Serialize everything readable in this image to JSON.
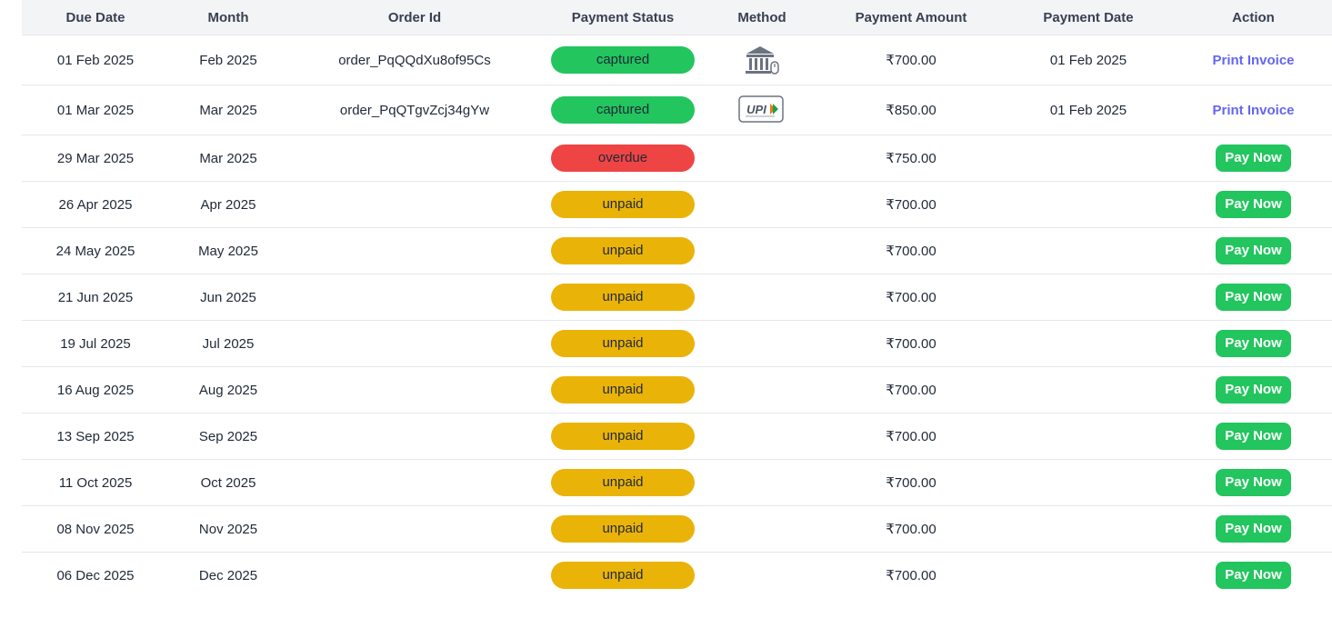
{
  "table": {
    "headers": [
      "Due Date",
      "Month",
      "Order Id",
      "Payment Status",
      "Method",
      "Payment Amount",
      "Payment Date",
      "Action"
    ],
    "rows": [
      {
        "due_date": "01 Feb 2025",
        "month": "Feb 2025",
        "order_id": "order_PqQQdXu8of95Cs",
        "status": "captured",
        "method_icon": "bank-icon",
        "amount": "₹700.00",
        "payment_date": "01 Feb 2025",
        "action": "Print Invoice"
      },
      {
        "due_date": "01 Mar 2025",
        "month": "Mar 2025",
        "order_id": "order_PqQTgvZcj34gYw",
        "status": "captured",
        "method_icon": "upi-icon",
        "amount": "₹850.00",
        "payment_date": "01 Feb 2025",
        "action": "Print Invoice"
      },
      {
        "due_date": "29 Mar 2025",
        "month": "Mar 2025",
        "order_id": "",
        "status": "overdue",
        "method_icon": "",
        "amount": "₹750.00",
        "payment_date": "",
        "action": "Pay Now"
      },
      {
        "due_date": "26 Apr 2025",
        "month": "Apr 2025",
        "order_id": "",
        "status": "unpaid",
        "method_icon": "",
        "amount": "₹700.00",
        "payment_date": "",
        "action": "Pay Now"
      },
      {
        "due_date": "24 May 2025",
        "month": "May 2025",
        "order_id": "",
        "status": "unpaid",
        "method_icon": "",
        "amount": "₹700.00",
        "payment_date": "",
        "action": "Pay Now"
      },
      {
        "due_date": "21 Jun 2025",
        "month": "Jun 2025",
        "order_id": "",
        "status": "unpaid",
        "method_icon": "",
        "amount": "₹700.00",
        "payment_date": "",
        "action": "Pay Now"
      },
      {
        "due_date": "19 Jul 2025",
        "month": "Jul 2025",
        "order_id": "",
        "status": "unpaid",
        "method_icon": "",
        "amount": "₹700.00",
        "payment_date": "",
        "action": "Pay Now"
      },
      {
        "due_date": "16 Aug 2025",
        "month": "Aug 2025",
        "order_id": "",
        "status": "unpaid",
        "method_icon": "",
        "amount": "₹700.00",
        "payment_date": "",
        "action": "Pay Now"
      },
      {
        "due_date": "13 Sep 2025",
        "month": "Sep 2025",
        "order_id": "",
        "status": "unpaid",
        "method_icon": "",
        "amount": "₹700.00",
        "payment_date": "",
        "action": "Pay Now"
      },
      {
        "due_date": "11 Oct 2025",
        "month": "Oct 2025",
        "order_id": "",
        "status": "unpaid",
        "method_icon": "",
        "amount": "₹700.00",
        "payment_date": "",
        "action": "Pay Now"
      },
      {
        "due_date": "08 Nov 2025",
        "month": "Nov 2025",
        "order_id": "",
        "status": "unpaid",
        "method_icon": "",
        "amount": "₹700.00",
        "payment_date": "",
        "action": "Pay Now"
      },
      {
        "due_date": "06 Dec 2025",
        "month": "Dec 2025",
        "order_id": "",
        "status": "unpaid",
        "method_icon": "",
        "amount": "₹700.00",
        "payment_date": "",
        "action": "Pay Now"
      }
    ]
  },
  "upi_label": "UPI",
  "colors": {
    "captured": "#22c55e",
    "overdue": "#ef4444",
    "unpaid": "#eab308",
    "link": "#6366f1",
    "pay_button": "#22c55e",
    "header_bg": "#f3f4f6"
  }
}
